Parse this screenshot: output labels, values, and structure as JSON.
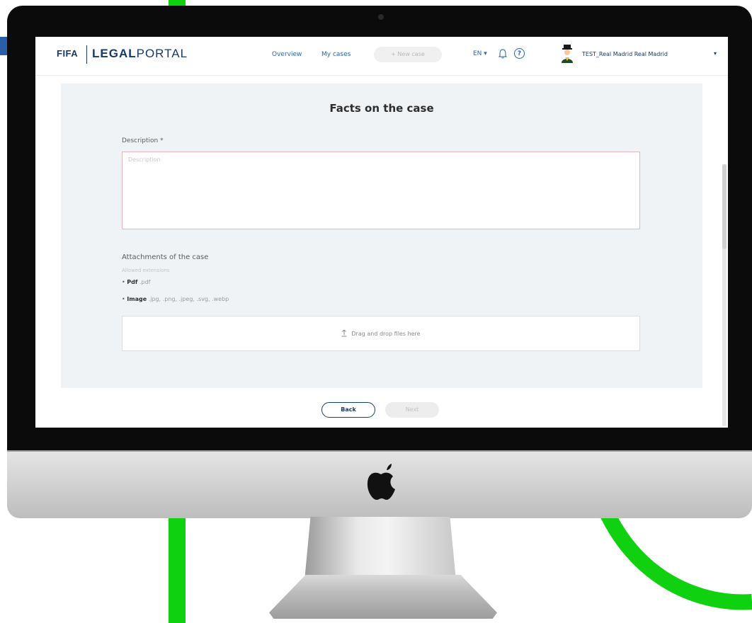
{
  "colors": {
    "accent_green": "#0fd10f",
    "brand_navy": "#163a6b",
    "link_blue": "#2b63b0",
    "panel_bg": "#f0f3f5"
  },
  "header": {
    "logo_fifa": "FIFA",
    "logo_legal": "LEGAL",
    "logo_portal": "PORTAL",
    "nav": {
      "overview": "Overview",
      "my_cases": "My cases"
    },
    "new_case": "+ New case",
    "language": "EN",
    "language_caret": "▾",
    "help_glyph": "?",
    "user_name": "TEST_Real Madrid Real Madrid",
    "user_caret": "▾",
    "icons": [
      "bell-icon",
      "help-icon",
      "avatar"
    ]
  },
  "form": {
    "title": "Facts on the case",
    "description_label": "Description *",
    "description_placeholder": "Description",
    "attachments_label": "Attachments of the case",
    "allowed_label": "Allowed extensions",
    "extensions": [
      {
        "bullet": "•",
        "name": "Pdf",
        "exts": ".pdf"
      },
      {
        "bullet": "•",
        "name": "Image",
        "exts": ".jpg, .png, .jpeg, .svg, .webp"
      }
    ],
    "dropzone_text": "Drag and drop files here"
  },
  "footer": {
    "back": "Back",
    "next": "Next"
  }
}
